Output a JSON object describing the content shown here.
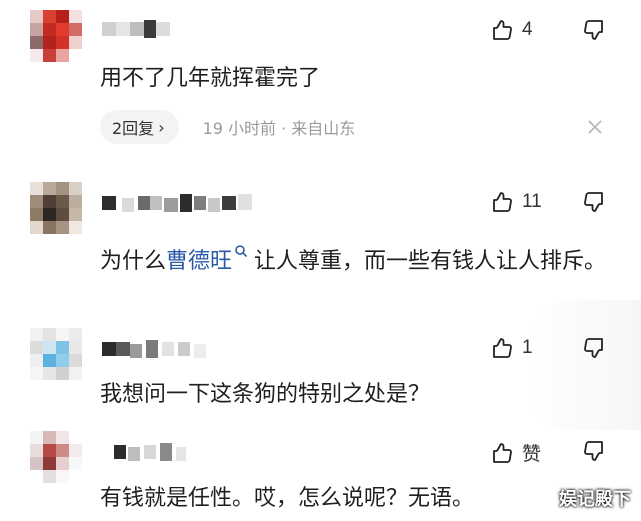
{
  "comments": [
    {
      "text": "用不了几年就挥霍完了",
      "likes": "4",
      "reply_label": "2回复",
      "reply_chevron": "›",
      "meta": "19 小时前 · 来自山东"
    },
    {
      "text_before": "为什么",
      "topic": "曹德旺",
      "text_after": "让人尊重，而一些有钱人让人排斥。",
      "likes": "11"
    },
    {
      "text": "我想问一下这条狗的特别之处是？",
      "likes": "1"
    },
    {
      "text": "有钱就是任性。哎，怎么说呢？无语。",
      "likes": "赞"
    }
  ],
  "watermark": "娱记殿下",
  "colors": {
    "topic_link": "#2b5aa8",
    "meta_text": "#9a9a9a",
    "reply_bg": "#f2f3f5"
  },
  "icons": {
    "like": "thumbs-up-icon",
    "dislike": "thumbs-down-icon",
    "close": "close-icon",
    "topic": "search-topic-icon"
  }
}
